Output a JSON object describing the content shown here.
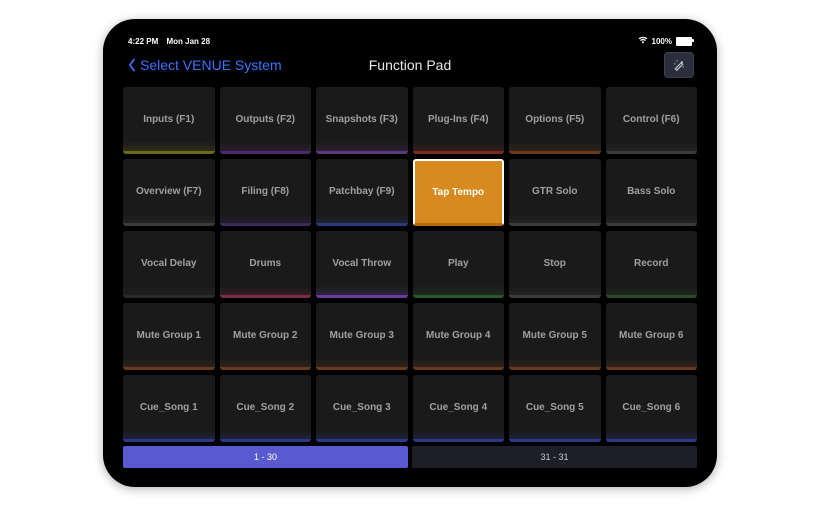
{
  "status": {
    "time": "4:22 PM",
    "date": "Mon Jan 28",
    "battery": "100%"
  },
  "nav": {
    "back_label": "Select VENUE System",
    "title": "Function Pad"
  },
  "colors": {
    "olive": "#6a6a1a",
    "purple": "#4a2a6a",
    "purple2": "#5a3a7a",
    "red": "#7a2a1a",
    "brown": "#6a3a1a",
    "gray": "#3a3a3a",
    "darkpurple": "#3a2a5a",
    "blue": "#2a3a7a",
    "gold": "#b87a2a",
    "dkgray": "#2a2a2a",
    "magenta": "#7a2a4a",
    "violet": "#6a3a9a",
    "green": "#2a5a2a",
    "dkgreen": "#2a4a2a",
    "blueb": "#2a3a8a"
  },
  "pads": [
    [
      {
        "label": "Inputs (F1)",
        "c": "olive"
      },
      {
        "label": "Outputs (F2)",
        "c": "purple"
      },
      {
        "label": "Snapshots (F3)",
        "c": "purple2"
      },
      {
        "label": "Plug-Ins (F4)",
        "c": "red"
      },
      {
        "label": "Options (F5)",
        "c": "brown"
      },
      {
        "label": "Control (F6)",
        "c": "gray"
      }
    ],
    [
      {
        "label": "Overview (F7)",
        "c": "gray"
      },
      {
        "label": "Filing (F8)",
        "c": "darkpurple"
      },
      {
        "label": "Patchbay (F9)",
        "c": "blue"
      },
      {
        "label": "Tap Tempo",
        "c": "gold",
        "active": true
      },
      {
        "label": "GTR Solo",
        "c": "gray"
      },
      {
        "label": "Bass Solo",
        "c": "gray"
      }
    ],
    [
      {
        "label": "Vocal Delay",
        "c": "dkgray"
      },
      {
        "label": "Drums",
        "c": "magenta"
      },
      {
        "label": "Vocal Throw",
        "c": "violet"
      },
      {
        "label": "Play",
        "c": "green"
      },
      {
        "label": "Stop",
        "c": "gray"
      },
      {
        "label": "Record",
        "c": "dkgreen"
      }
    ],
    [
      {
        "label": "Mute Group 1",
        "c": "brown"
      },
      {
        "label": "Mute Group 2",
        "c": "brown"
      },
      {
        "label": "Mute Group 3",
        "c": "brown"
      },
      {
        "label": "Mute Group 4",
        "c": "brown"
      },
      {
        "label": "Mute Group 5",
        "c": "brown"
      },
      {
        "label": "Mute Group 6",
        "c": "brown"
      }
    ],
    [
      {
        "label": "Cue_Song 1",
        "c": "blueb"
      },
      {
        "label": "Cue_Song 2",
        "c": "blueb"
      },
      {
        "label": "Cue_Song 3",
        "c": "blueb"
      },
      {
        "label": "Cue_Song 4",
        "c": "blueb"
      },
      {
        "label": "Cue_Song 5",
        "c": "blueb"
      },
      {
        "label": "Cue_Song 6",
        "c": "blueb"
      }
    ]
  ],
  "pager": [
    {
      "label": "1 - 30",
      "selected": true
    },
    {
      "label": "31 - 31",
      "selected": false
    }
  ]
}
